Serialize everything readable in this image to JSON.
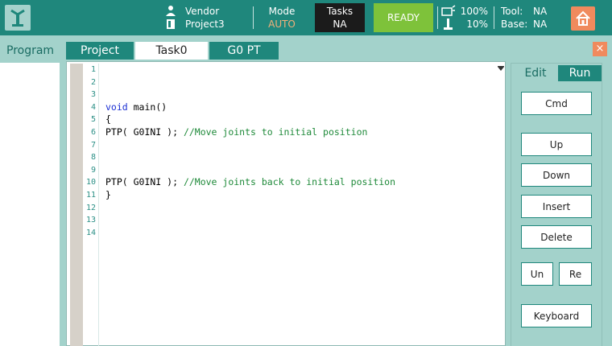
{
  "header": {
    "user": "Vendor",
    "project": "Project3",
    "mode_label": "Mode",
    "mode_value": "AUTO",
    "tasks_label": "Tasks",
    "tasks_value": "NA",
    "status": "READY",
    "speed1": "100%",
    "speed2": "10%",
    "tool_label": "Tool:",
    "tool_value": "NA",
    "base_label": "Base:",
    "base_value": "NA"
  },
  "tabs": {
    "program": "Program",
    "project": "Project",
    "task0": "Task0",
    "g0pt": "G0 PT",
    "close": "×"
  },
  "editor": {
    "line_numbers": [
      "1",
      "2",
      "3",
      "4",
      "5",
      "6",
      "7",
      "8",
      "9",
      "10",
      "11",
      "12",
      "13",
      "14"
    ],
    "lines": [
      {
        "kw": "",
        "text": "",
        "comment": ""
      },
      {
        "kw": "",
        "text": "",
        "comment": ""
      },
      {
        "kw": "",
        "text": "",
        "comment": ""
      },
      {
        "kw": "void",
        "text": " main()",
        "comment": ""
      },
      {
        "kw": "",
        "text": "{",
        "comment": ""
      },
      {
        "kw": "",
        "text": "PTP( G0INI ); ",
        "comment": "//Move joints to initial position"
      },
      {
        "kw": "",
        "text": "",
        "comment": ""
      },
      {
        "kw": "",
        "text": "",
        "comment": ""
      },
      {
        "kw": "",
        "text": "",
        "comment": ""
      },
      {
        "kw": "",
        "text": "PTP( G0INI ); ",
        "comment": "//Move joints back to initial position"
      },
      {
        "kw": "",
        "text": "}",
        "comment": ""
      },
      {
        "kw": "",
        "text": "",
        "comment": ""
      },
      {
        "kw": "",
        "text": "",
        "comment": ""
      },
      {
        "kw": "",
        "text": "",
        "comment": ""
      }
    ],
    "colors": {
      "keyword": "#1a2ed3",
      "comment": "#1f8a3a",
      "line_number": "#2a8f85"
    }
  },
  "side": {
    "edit_tab": "Edit",
    "run_tab": "Run",
    "cmd": "Cmd",
    "up": "Up",
    "down": "Down",
    "insert": "Insert",
    "delete": "Delete",
    "undo": "Un",
    "redo": "Re",
    "keyboard": "Keyboard"
  },
  "colors": {
    "primary": "#1f877c",
    "panel": "#a3d2cb",
    "ready": "#7ec23a",
    "accent": "#f08a5d",
    "mode_value": "#f3b079"
  }
}
